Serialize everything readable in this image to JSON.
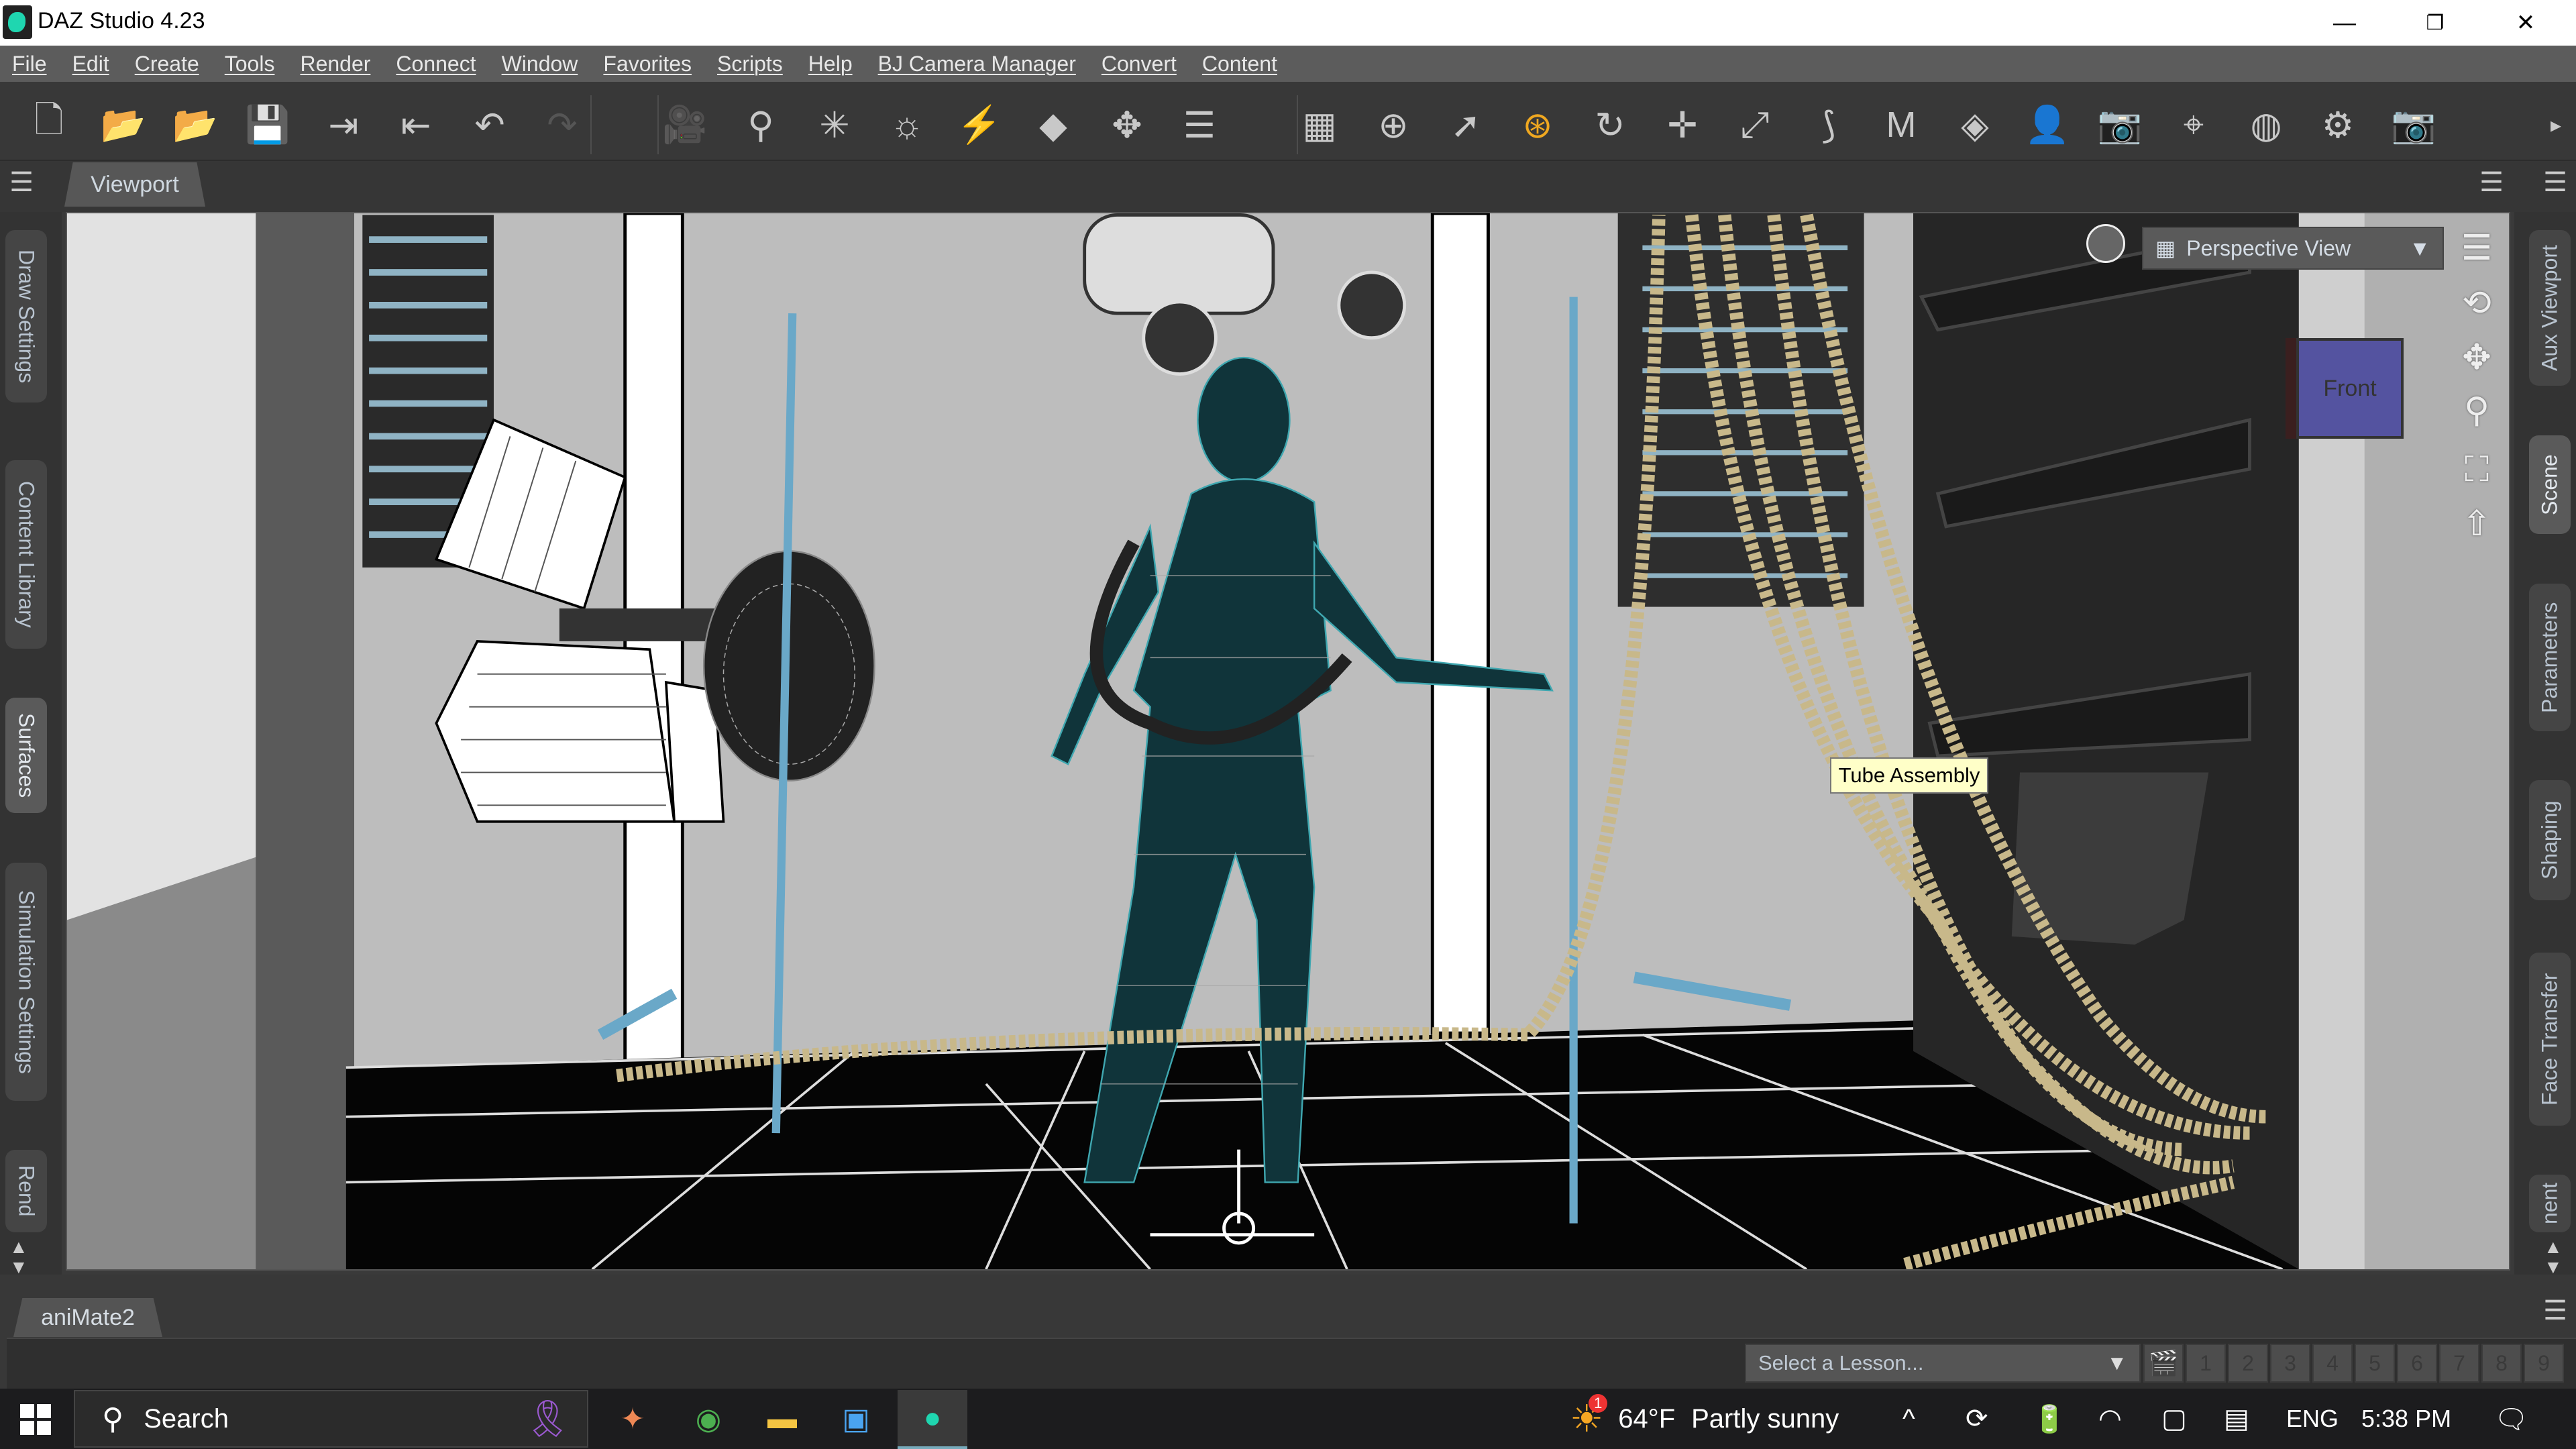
{
  "window": {
    "title": "DAZ Studio 4.23",
    "minimize": "—",
    "restore": "❐",
    "close": "✕"
  },
  "menu": [
    "File",
    "Edit",
    "Create",
    "Tools",
    "Render",
    "Connect",
    "Window",
    "Favorites",
    "Scripts",
    "Help",
    "BJ Camera Manager",
    "Convert",
    "Content"
  ],
  "toolbar": {
    "icons": [
      {
        "name": "new-scene-icon",
        "glyph": "🗋"
      },
      {
        "name": "open-icon",
        "glyph": "📂"
      },
      {
        "name": "merge-icon",
        "glyph": "📂"
      },
      {
        "name": "save-icon",
        "glyph": "💾"
      },
      {
        "name": "import-icon",
        "glyph": "⇥"
      },
      {
        "name": "export-icon",
        "glyph": "⇤"
      },
      {
        "name": "undo-icon",
        "glyph": "↶"
      },
      {
        "name": "redo-icon",
        "glyph": "↷"
      },
      {
        "name": "create-camera-icon",
        "glyph": "🎥"
      },
      {
        "name": "create-spotlight-icon",
        "glyph": "⚲"
      },
      {
        "name": "create-point-light-icon",
        "glyph": "✳"
      },
      {
        "name": "create-distant-light-icon",
        "glyph": "☼"
      },
      {
        "name": "create-linear-light-icon",
        "glyph": "⚡"
      },
      {
        "name": "create-primitive-icon",
        "glyph": "◆"
      },
      {
        "name": "create-null-icon",
        "glyph": "✥"
      },
      {
        "name": "tool-settings-icon",
        "glyph": "☰"
      },
      {
        "name": "viewport-grid-icon",
        "glyph": "▦"
      },
      {
        "name": "universal-tool-icon",
        "glyph": "⊕"
      },
      {
        "name": "node-selection-icon",
        "glyph": "➚"
      },
      {
        "name": "active-pose-tool-icon",
        "glyph": "⊛"
      },
      {
        "name": "rotate-tool-icon",
        "glyph": "↻"
      },
      {
        "name": "translate-tool-icon",
        "glyph": "✛"
      },
      {
        "name": "scale-tool-icon",
        "glyph": "⤢"
      },
      {
        "name": "joint-editor-icon",
        "glyph": "⟆"
      },
      {
        "name": "geometry-editor-icon",
        "glyph": "M"
      },
      {
        "name": "surface-selection-icon",
        "glyph": "◈"
      },
      {
        "name": "figure-setup-icon",
        "glyph": "👤"
      },
      {
        "name": "camera-cube-icon",
        "glyph": "📷"
      },
      {
        "name": "region-navigator-icon",
        "glyph": "⌖"
      },
      {
        "name": "iray-preview-icon",
        "glyph": "◍"
      },
      {
        "name": "render-settings-icon",
        "glyph": "⚙"
      },
      {
        "name": "render-icon",
        "glyph": "📷"
      }
    ],
    "overflow": "▸"
  },
  "tabs": {
    "viewport": "Viewport",
    "panel_menu": "☰"
  },
  "left_tabs": [
    "Draw Settings",
    "Content Library",
    "Surfaces",
    "Simulation Settings",
    "Rend"
  ],
  "right_tabs": [
    "Aux Viewport",
    "Scene",
    "Parameters",
    "Shaping",
    "Face Transfer",
    "nent"
  ],
  "viewport": {
    "camera": "Perspective View",
    "dropdown_arrow": "▼",
    "navcube_face": "Front",
    "tooltip": "Tube Assembly",
    "nav_icons": [
      {
        "name": "viewport-menu-icon",
        "glyph": "☰"
      },
      {
        "name": "orbit-icon",
        "glyph": "⟲"
      },
      {
        "name": "pan-icon",
        "glyph": "✥"
      },
      {
        "name": "zoom-icon",
        "glyph": "⚲"
      },
      {
        "name": "frame-icon",
        "glyph": "⛶"
      },
      {
        "name": "reset-view-icon",
        "glyph": "⇧"
      }
    ]
  },
  "bottom": {
    "animate_tab": "aniMate2",
    "lesson_placeholder": "Select a Lesson...",
    "lesson_numbers": [
      "1",
      "2",
      "3",
      "4",
      "5",
      "6",
      "7",
      "8",
      "9"
    ]
  },
  "taskbar": {
    "search": "Search",
    "weather_temp": "64°F",
    "weather_desc": "Partly sunny",
    "weather_badge": "1",
    "language": "ENG",
    "time": "5:38 PM"
  }
}
